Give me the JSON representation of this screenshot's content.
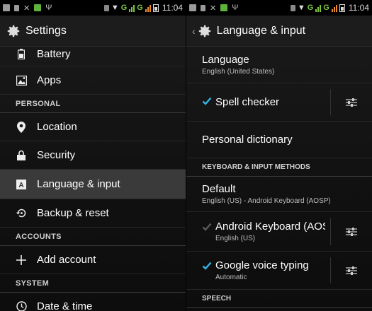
{
  "status": {
    "time": "11:04",
    "network": "G"
  },
  "left": {
    "title": "Settings",
    "items": [
      {
        "type": "item",
        "label": "Battery",
        "icon": "battery-icon"
      },
      {
        "type": "item",
        "label": "Apps",
        "icon": "apps-icon"
      },
      {
        "type": "section",
        "label": "PERSONAL"
      },
      {
        "type": "item",
        "label": "Location",
        "icon": "location-icon"
      },
      {
        "type": "item",
        "label": "Security",
        "icon": "lock-icon"
      },
      {
        "type": "item",
        "label": "Language & input",
        "icon": "language-icon",
        "selected": true
      },
      {
        "type": "item",
        "label": "Backup & reset",
        "icon": "backup-icon"
      },
      {
        "type": "section",
        "label": "ACCOUNTS"
      },
      {
        "type": "item",
        "label": "Add account",
        "icon": "plus-icon"
      },
      {
        "type": "section",
        "label": "SYSTEM"
      },
      {
        "type": "item",
        "label": "Date & time",
        "icon": "clock-icon"
      }
    ]
  },
  "right": {
    "title": "Language & input",
    "language": {
      "title": "Language",
      "subtitle": "English (United States)"
    },
    "spell_checker": {
      "label": "Spell checker",
      "checked": true
    },
    "personal_dictionary": "Personal dictionary",
    "section_keyboard": "KEYBOARD & INPUT METHODS",
    "default": {
      "title": "Default",
      "subtitle": "English (US) - Android Keyboard (AOSP)"
    },
    "android_keyboard": {
      "title": "Android Keyboard (AOSP)",
      "subtitle": "English (US)",
      "checked": true,
      "disabled": true
    },
    "google_voice": {
      "title": "Google voice typing",
      "subtitle": "Automatic",
      "checked": true
    },
    "section_speech": "SPEECH"
  },
  "colors": {
    "accent": "#33b5e5",
    "selected_bg": "#3a3a3a"
  }
}
